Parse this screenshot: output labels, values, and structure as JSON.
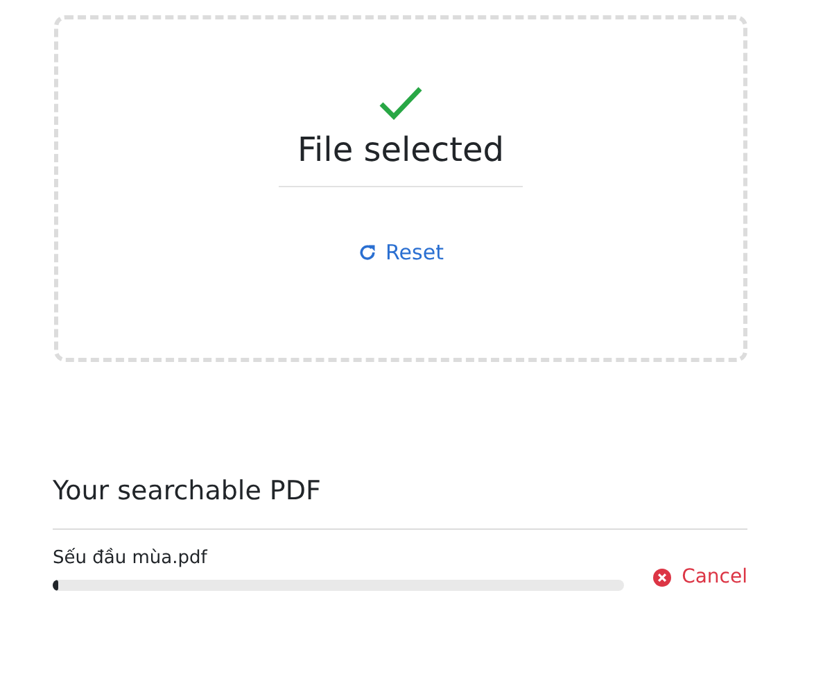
{
  "dropzone": {
    "status": "File selected",
    "reset": "Reset"
  },
  "result": {
    "heading": "Your searchable PDF",
    "files": [
      {
        "name": "Sếu đầu mùa.pdf",
        "level": 0.01,
        "cancel": "Cancel"
      }
    ]
  }
}
